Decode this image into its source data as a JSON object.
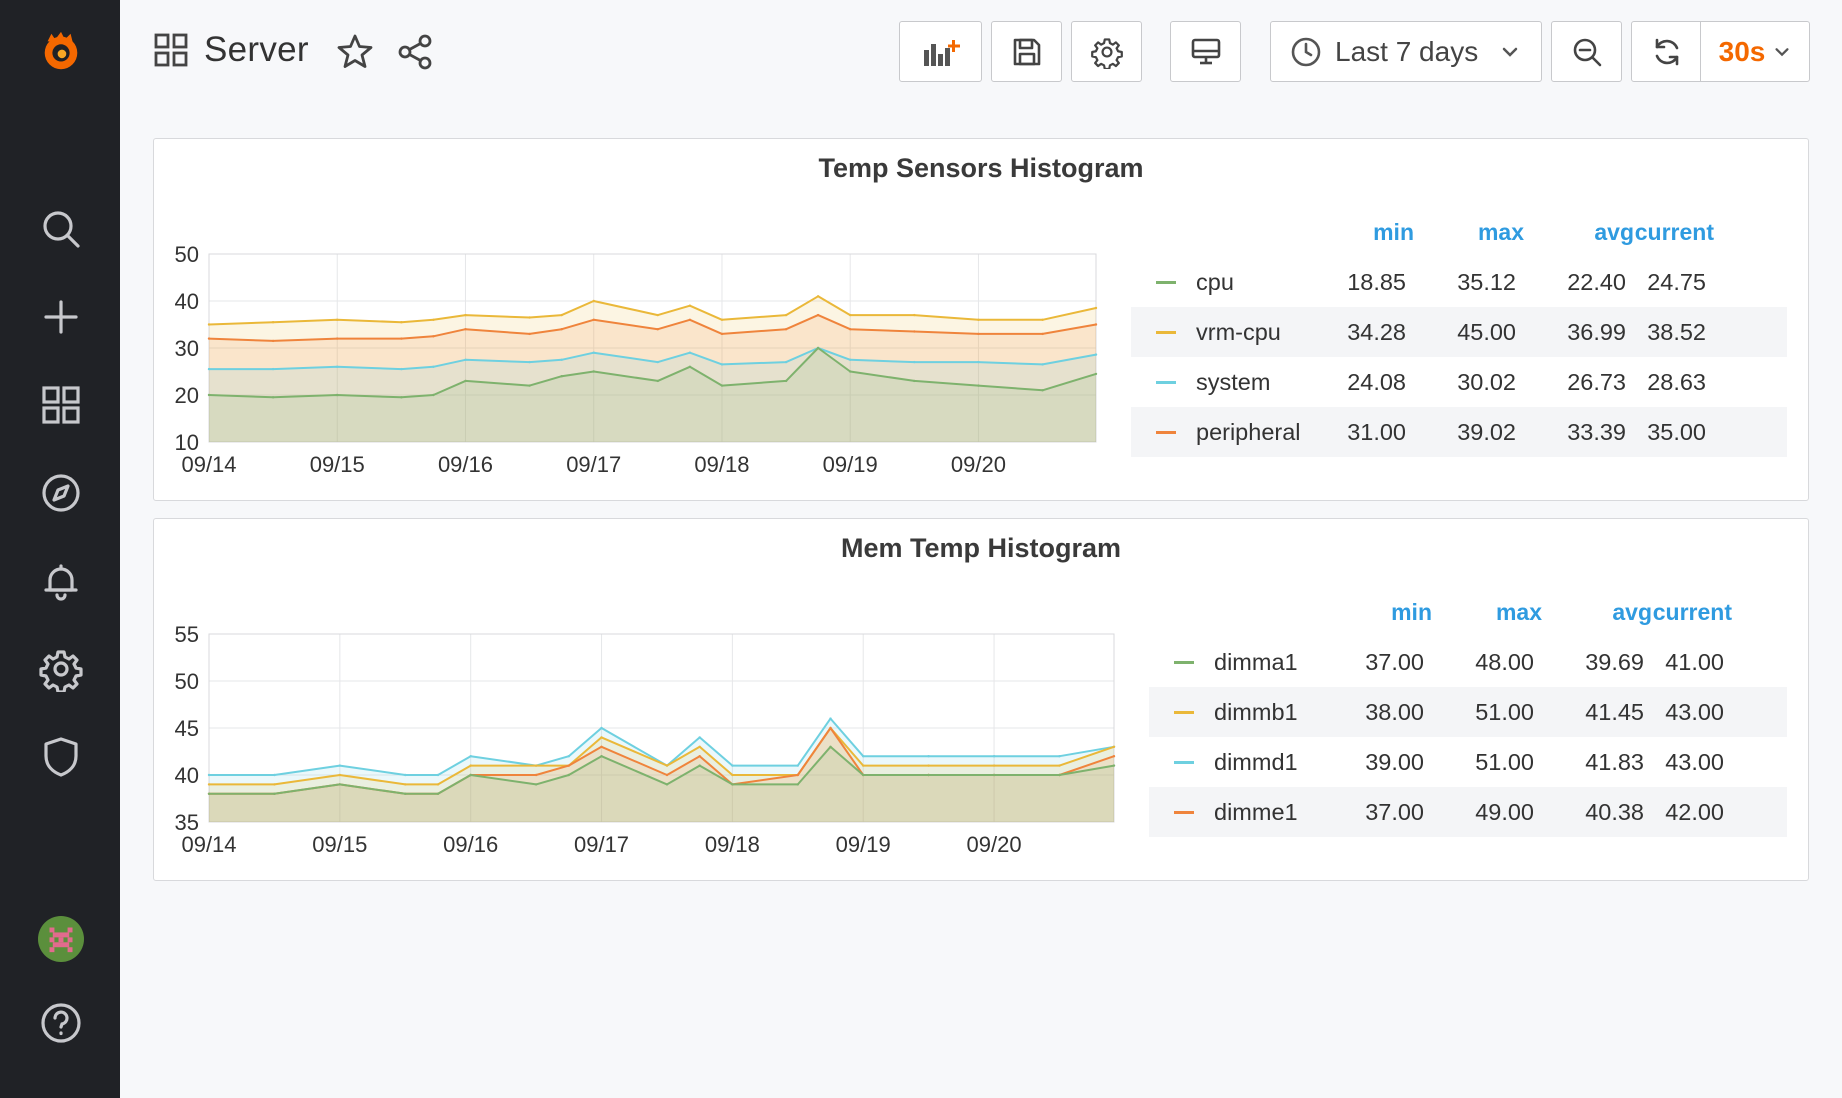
{
  "sidebar": {
    "items": [
      "grafana-logo",
      "search",
      "create",
      "dashboards",
      "explore",
      "alerting",
      "configuration",
      "server-admin",
      "user-avatar",
      "help"
    ]
  },
  "header": {
    "title": "Server",
    "time_range": "Last 7 days",
    "refresh_interval": "30s",
    "refresh_color": "#f46800"
  },
  "panels": [
    {
      "title": "Temp Sensors Histogram",
      "legend_headers": [
        "min",
        "max",
        "avg",
        "current"
      ],
      "legend": [
        {
          "name": "cpu",
          "color": "#7eb26d",
          "min": "18.85",
          "max": "35.12",
          "avg": "22.40",
          "current": "24.75"
        },
        {
          "name": "vrm-cpu",
          "color": "#eab839",
          "min": "34.28",
          "max": "45.00",
          "avg": "36.99",
          "current": "38.52"
        },
        {
          "name": "system",
          "color": "#6ed0e0",
          "min": "24.08",
          "max": "30.02",
          "avg": "26.73",
          "current": "28.63"
        },
        {
          "name": "peripheral",
          "color": "#ef843c",
          "min": "31.00",
          "max": "39.02",
          "avg": "33.39",
          "current": "35.00"
        }
      ]
    },
    {
      "title": "Mem Temp Histogram",
      "legend_headers": [
        "min",
        "max",
        "avg",
        "current"
      ],
      "legend": [
        {
          "name": "dimma1",
          "color": "#7eb26d",
          "min": "37.00",
          "max": "48.00",
          "avg": "39.69",
          "current": "41.00"
        },
        {
          "name": "dimmb1",
          "color": "#eab839",
          "min": "38.00",
          "max": "51.00",
          "avg": "41.45",
          "current": "43.00"
        },
        {
          "name": "dimmd1",
          "color": "#6ed0e0",
          "min": "39.00",
          "max": "51.00",
          "avg": "41.83",
          "current": "43.00"
        },
        {
          "name": "dimme1",
          "color": "#ef843c",
          "min": "37.00",
          "max": "49.00",
          "avg": "40.38",
          "current": "42.00"
        }
      ]
    }
  ],
  "chart_data": [
    {
      "type": "line",
      "title": "Temp Sensors Histogram",
      "x_ticks": [
        "09/14",
        "09/15",
        "09/16",
        "09/17",
        "09/18",
        "09/19",
        "09/20"
      ],
      "y_ticks": [
        10,
        20,
        30,
        40,
        50
      ],
      "ylim": [
        10,
        50
      ],
      "xlim": [
        "09/14",
        "09/20 22:00"
      ],
      "grid": true,
      "legend_placement": "right",
      "x": [
        "09/14 00:00",
        "09/14 12:00",
        "09/15 00:00",
        "09/15 12:00",
        "09/15 18:00",
        "09/16 00:00",
        "09/16 12:00",
        "09/16 18:00",
        "09/17 00:00",
        "09/17 12:00",
        "09/17 18:00",
        "09/18 00:00",
        "09/18 12:00",
        "09/18 18:00",
        "09/19 00:00",
        "09/19 12:00",
        "09/20 00:00",
        "09/20 12:00",
        "09/20 22:00"
      ],
      "series": [
        {
          "name": "cpu",
          "color": "#7eb26d",
          "values": [
            20,
            19.5,
            20,
            19.5,
            20,
            23,
            22,
            24,
            25,
            23,
            26,
            22,
            23,
            30,
            25,
            23,
            22,
            21,
            24.5
          ]
        },
        {
          "name": "vrm-cpu",
          "color": "#eab839",
          "values": [
            35,
            35.5,
            36,
            35.5,
            36,
            37,
            36.5,
            37,
            40,
            37,
            39,
            36,
            37,
            41,
            37,
            37,
            36,
            36,
            38.5
          ]
        },
        {
          "name": "system",
          "color": "#6ed0e0",
          "values": [
            25.5,
            25.5,
            26,
            25.5,
            26,
            27.5,
            27,
            27.5,
            29,
            27,
            29,
            26.5,
            27,
            30,
            27.5,
            27,
            27,
            26.5,
            28.6
          ]
        },
        {
          "name": "peripheral",
          "color": "#ef843c",
          "values": [
            32,
            31.5,
            32,
            32,
            32.5,
            34,
            33,
            34,
            36,
            34,
            36,
            33,
            34,
            37,
            34,
            33.5,
            33,
            33,
            35
          ]
        }
      ]
    },
    {
      "type": "line",
      "title": "Mem Temp Histogram",
      "x_ticks": [
        "09/14",
        "09/15",
        "09/16",
        "09/17",
        "09/18",
        "09/19",
        "09/20"
      ],
      "y_ticks": [
        35,
        40,
        45,
        50,
        55
      ],
      "ylim": [
        35,
        55
      ],
      "xlim": [
        "09/14",
        "09/20 22:00"
      ],
      "grid": true,
      "legend_placement": "right",
      "x": [
        "09/14 00:00",
        "09/14 12:00",
        "09/15 00:00",
        "09/15 12:00",
        "09/15 18:00",
        "09/16 00:00",
        "09/16 12:00",
        "09/16 18:00",
        "09/17 00:00",
        "09/17 12:00",
        "09/17 18:00",
        "09/18 00:00",
        "09/18 12:00",
        "09/18 18:00",
        "09/19 00:00",
        "09/19 12:00",
        "09/20 00:00",
        "09/20 12:00",
        "09/20 22:00"
      ],
      "series": [
        {
          "name": "dimma1",
          "color": "#7eb26d",
          "values": [
            38,
            38,
            39,
            38,
            38,
            40,
            39,
            40,
            42,
            39,
            41,
            39,
            39,
            43,
            40,
            40,
            40,
            40,
            41
          ]
        },
        {
          "name": "dimmb1",
          "color": "#eab839",
          "values": [
            39,
            39,
            40,
            39,
            39,
            41,
            41,
            41,
            44,
            41,
            43,
            40,
            40,
            45,
            41,
            41,
            41,
            41,
            43
          ]
        },
        {
          "name": "dimmd1",
          "color": "#6ed0e0",
          "values": [
            40,
            40,
            41,
            40,
            40,
            42,
            41,
            42,
            45,
            41,
            44,
            41,
            41,
            46,
            42,
            42,
            42,
            42,
            43
          ]
        },
        {
          "name": "dimme1",
          "color": "#ef843c",
          "values": [
            38,
            38,
            39,
            38,
            38,
            40,
            40,
            41,
            43,
            40,
            42,
            39,
            40,
            45,
            40,
            40,
            40,
            40,
            42
          ]
        }
      ]
    }
  ]
}
